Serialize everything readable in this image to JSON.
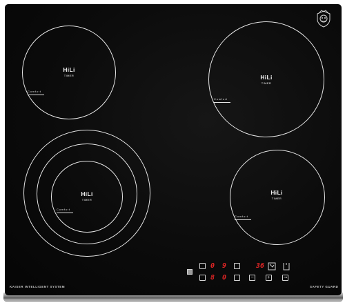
{
  "zones": [
    {
      "id": "rear-left",
      "label": "HiLi",
      "sub": "TIMER",
      "comfort": "Comfort"
    },
    {
      "id": "front-left",
      "label": "HiLi",
      "sub": "TIMER",
      "comfort": "Comfort"
    },
    {
      "id": "rear-right",
      "label": "HiLi",
      "sub": "TIMER",
      "comfort": "Comfort"
    },
    {
      "id": "front-right",
      "label": "HiLi",
      "sub": "TIMER",
      "comfort": "Comfort"
    }
  ],
  "brand_left": "KAISER INTELLIGENT SYSTEM",
  "brand_right": "SAFETY GUARD",
  "display": {
    "top_digit_1": "0",
    "top_digit_2": "9",
    "bottom_digit_1": "8",
    "bottom_digit_2": "0",
    "timer_value": "36"
  },
  "controls": {
    "minus_symbol": "−",
    "plus_symbol": "+",
    "lock_symbol": "⊸"
  },
  "colors": {
    "glass": "#0b0b0b",
    "ring": "#e6e6e6",
    "display": "#e02525"
  },
  "icons": [
    "kaiser-logo-icon",
    "clock-icon",
    "timer-bracket-icon",
    "power-icon",
    "lock-icon"
  ]
}
